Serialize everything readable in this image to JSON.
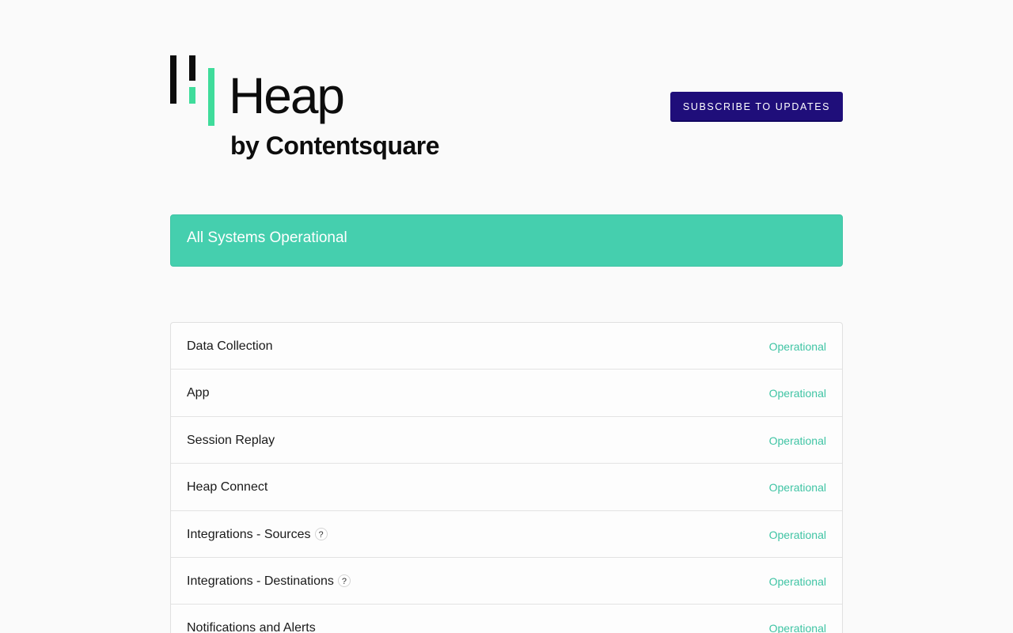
{
  "header": {
    "logo_word": "Heap",
    "logo_sub": "by Contentsquare",
    "subscribe_label": "SUBSCRIBE TO UPDATES"
  },
  "banner": {
    "text": "All Systems Operational",
    "color": "#45cfae"
  },
  "components": [
    {
      "name": "Data Collection",
      "status": "Operational",
      "help": ""
    },
    {
      "name": "App",
      "status": "Operational",
      "help": ""
    },
    {
      "name": "Session Replay",
      "status": "Operational",
      "help": ""
    },
    {
      "name": "Heap Connect",
      "status": "Operational",
      "help": ""
    },
    {
      "name": "Integrations - Sources",
      "status": "Operational",
      "help": "?"
    },
    {
      "name": "Integrations - Destinations",
      "status": "Operational",
      "help": "?"
    },
    {
      "name": "Notifications and Alerts",
      "status": "Operational",
      "help": ""
    }
  ],
  "colors": {
    "accent": "#1f0e7a",
    "operational": "#3fc4a4",
    "logo_green": "#3fdc9b",
    "logo_dark": "#0d0d0d"
  }
}
